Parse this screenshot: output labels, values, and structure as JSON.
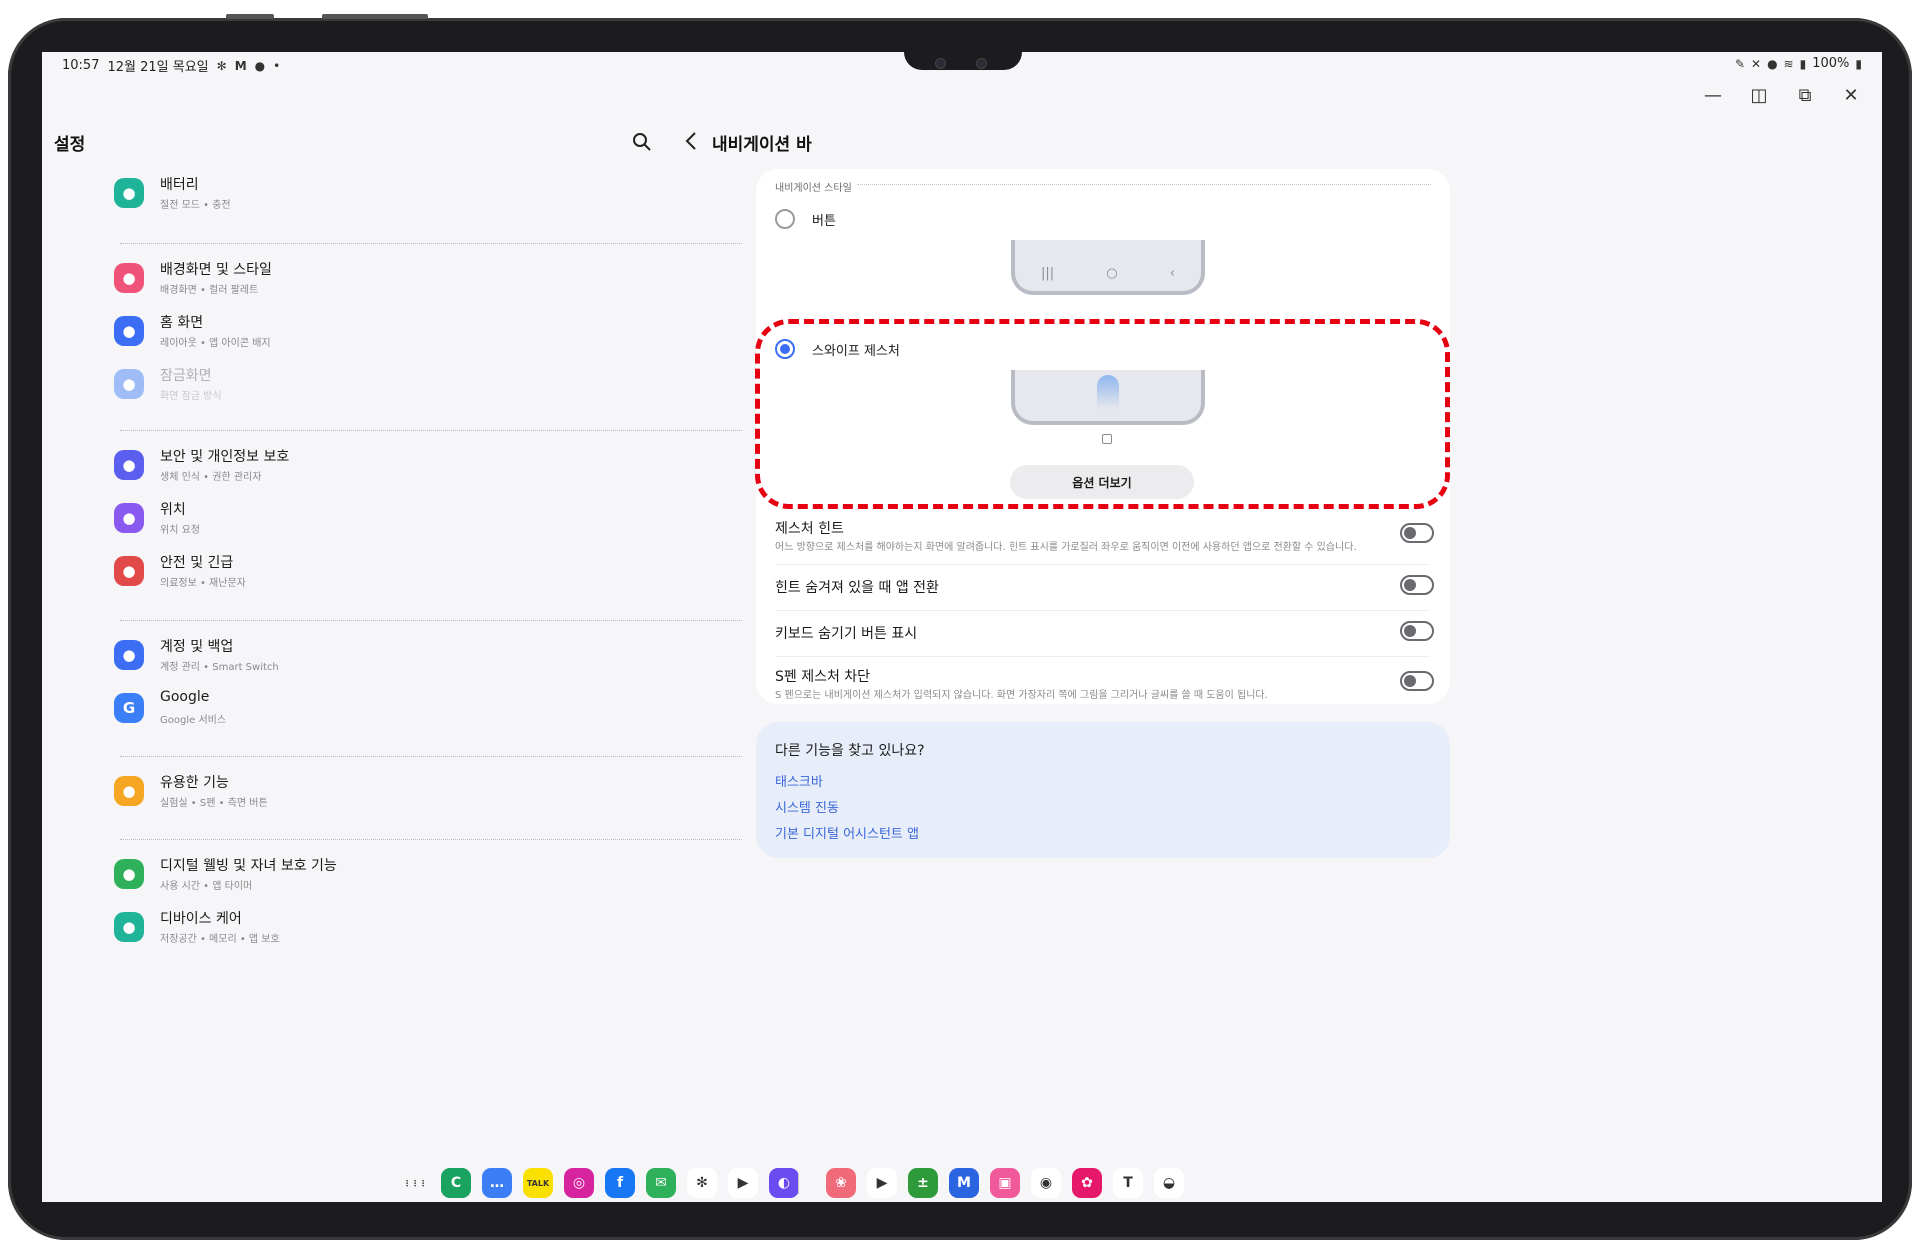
{
  "status_bar": {
    "time": "10:57",
    "date": "12월 21일 목요일",
    "battery": "100%",
    "left_icons": [
      "fan-icon",
      "m-app-icon",
      "talk-icon",
      "dot-icon"
    ],
    "right_icons": [
      "pen-icon",
      "mute-icon",
      "location-icon",
      "wifi-icon",
      "signal-icon",
      "battery-icon"
    ]
  },
  "window_controls": [
    "minimize-icon",
    "split-icon",
    "popup-icon",
    "close-icon"
  ],
  "left": {
    "title": "설정",
    "groups": [
      [
        {
          "title": "배터리",
          "sub": "절전 모드 • 충전",
          "icon": "battery-icon",
          "color": "#1fb39a"
        }
      ],
      [
        {
          "title": "배경화면 및 스타일",
          "sub": "배경화면 • 컬러 팔레트",
          "icon": "wallpaper-icon",
          "color": "#f0537a"
        },
        {
          "title": "홈 화면",
          "sub": "레이아웃 • 앱 아이콘 배지",
          "icon": "home-icon",
          "color": "#3b6ef5"
        },
        {
          "title": "잠금화면",
          "sub": "화면 잠금 방식",
          "icon": "lock-icon",
          "color": "#9fbcf6",
          "dim": true
        }
      ],
      [
        {
          "title": "보안 및 개인정보 보호",
          "sub": "생체 인식 • 권한 관리자",
          "icon": "shield-icon",
          "color": "#5b5ff0"
        },
        {
          "title": "위치",
          "sub": "위치 요청",
          "icon": "location-icon",
          "color": "#8a59f0"
        },
        {
          "title": "안전 및 긴급",
          "sub": "의료정보 • 재난문자",
          "icon": "alert-icon",
          "color": "#e24a4a"
        }
      ],
      [
        {
          "title": "계정 및 백업",
          "sub": "계정 관리 • Smart Switch",
          "icon": "sync-icon",
          "color": "#3b6ef5"
        },
        {
          "title": "Google",
          "sub": "Google 서비스",
          "icon": "google-icon",
          "color": "#3b7ef5"
        }
      ],
      [
        {
          "title": "유용한 기능",
          "sub": "실험실 • S펜 • 측면 버튼",
          "icon": "star-icon",
          "color": "#f5a623"
        }
      ],
      [
        {
          "title": "디지털 웰빙 및 자녀 보호 기능",
          "sub": "사용 시간 • 앱 타이머",
          "icon": "wellbeing-icon",
          "color": "#2fb05a"
        },
        {
          "title": "디바이스 케어",
          "sub": "저장공간 • 메모리 • 앱 보호",
          "icon": "device-care-icon",
          "color": "#1fb39a"
        }
      ]
    ]
  },
  "right": {
    "title": "내비게이션 바",
    "section_label": "내비게이션 스타일",
    "option_buttons": "버튼",
    "option_gesture": "스와이프 제스처",
    "more_options": "옵션 더보기",
    "rows": [
      {
        "title": "제스처 힌트",
        "sub": "어느 방향으로 제스처를 해야하는지 화면에 알려줍니다. 힌트 표시를 가로질러 좌우로 움직이면 이전에 사용하던 앱으로 전환할 수 있습니다.",
        "on": false
      },
      {
        "title": "힌트 숨겨져 있을 때 앱 전환",
        "sub": "",
        "on": false
      },
      {
        "title": "키보드 숨기기 버튼 표시",
        "sub": "",
        "on": false
      },
      {
        "title": "S펜 제스처 차단",
        "sub": "S 펜으로는 내비게이션 제스처가 입력되지 않습니다. 화면 가장자리 쪽에 그림을 그리거나 글씨를 쓸 때 도움이 됩니다.",
        "on": false
      }
    ],
    "suggest": {
      "title": "다른 기능을 찾고 있나요?",
      "links": [
        "태스크바",
        "시스템 진동",
        "기본 디지털 어시스턴트 앱"
      ]
    }
  },
  "dock": {
    "apps": [
      {
        "name": "app-drawer-icon",
        "color": "#f6f6f8",
        "glyph": "⋮⋮⋮"
      },
      {
        "name": "phone-icon",
        "color": "#1aa260",
        "glyph": "C"
      },
      {
        "name": "messages-icon",
        "color": "#3b7ef5",
        "glyph": "…"
      },
      {
        "name": "kakaotalk-icon",
        "color": "#f9e000",
        "glyph": "TALK"
      },
      {
        "name": "instagram-icon",
        "color": "#d6249f",
        "glyph": "◎"
      },
      {
        "name": "facebook-icon",
        "color": "#1877f2",
        "glyph": "f"
      },
      {
        "name": "email-icon",
        "color": "#2fb05a",
        "glyph": "✉"
      },
      {
        "name": "bixby-routines-icon",
        "color": "#ffffff",
        "glyph": "✻"
      },
      {
        "name": "youtube-music-icon",
        "color": "#ffffff",
        "glyph": "▶"
      },
      {
        "name": "internet-icon",
        "color": "#6a4cf0",
        "glyph": "◐"
      },
      {
        "name": "gallery-icon",
        "color": "#f06a7a",
        "glyph": "❀"
      },
      {
        "name": "youtube-icon",
        "color": "#ffffff",
        "glyph": "▶"
      },
      {
        "name": "calculator-icon",
        "color": "#2f9a3a",
        "glyph": "±"
      },
      {
        "name": "m-app-icon",
        "color": "#2a64e0",
        "glyph": "M"
      },
      {
        "name": "store-icon",
        "color": "#f05a9a",
        "glyph": "▣"
      },
      {
        "name": "recorder-icon",
        "color": "#ffffff",
        "glyph": "◉"
      },
      {
        "name": "blossom-icon",
        "color": "#e6186a",
        "glyph": "✿"
      },
      {
        "name": "t-app-icon",
        "color": "#ffffff",
        "glyph": "T"
      },
      {
        "name": "leaf-app-icon",
        "color": "#ffffff",
        "glyph": "◒"
      }
    ]
  }
}
